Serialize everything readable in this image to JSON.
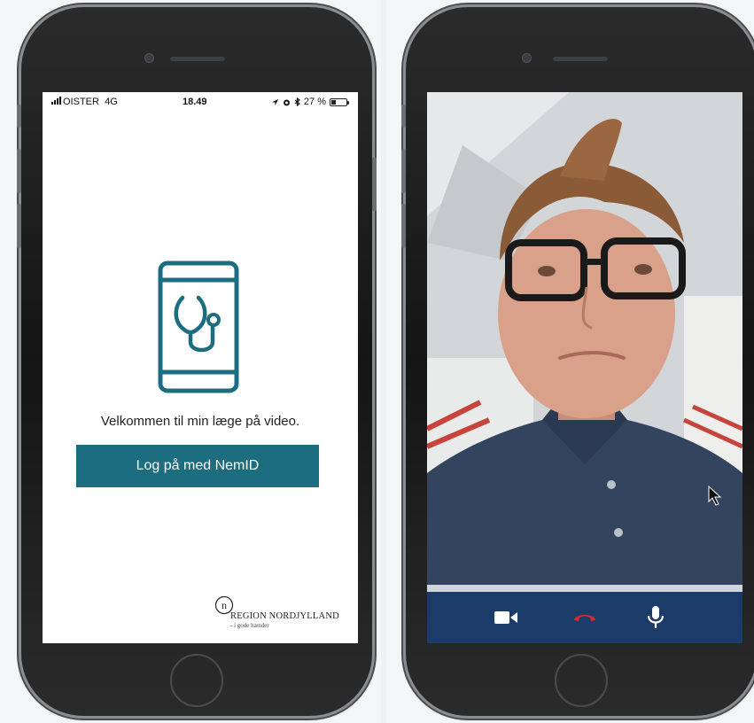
{
  "left_phone": {
    "status_bar": {
      "carrier": "OISTER",
      "network": "4G",
      "time": "18.49",
      "battery_percent": "27 %",
      "indicators": [
        "location-arrow-icon",
        "alarm-icon",
        "bluetooth-icon",
        "battery-icon"
      ]
    },
    "app_icon": "phone-stethoscope-icon",
    "welcome_text": "Velkommen til min læge på video.",
    "login_button_label": "Log på med NemID",
    "region_logo": {
      "mark": "n",
      "name": "REGION NORDJYLLAND",
      "tagline": "- i gode hænder"
    }
  },
  "right_phone": {
    "video_call": {
      "progress": 1.0,
      "controls": [
        "camera-icon",
        "hang-up-icon",
        "microphone-icon"
      ]
    }
  },
  "colors": {
    "brand_teal": "#1c6d7f",
    "control_bar": "#1b3b68",
    "hang_up_red": "#d9272e"
  }
}
